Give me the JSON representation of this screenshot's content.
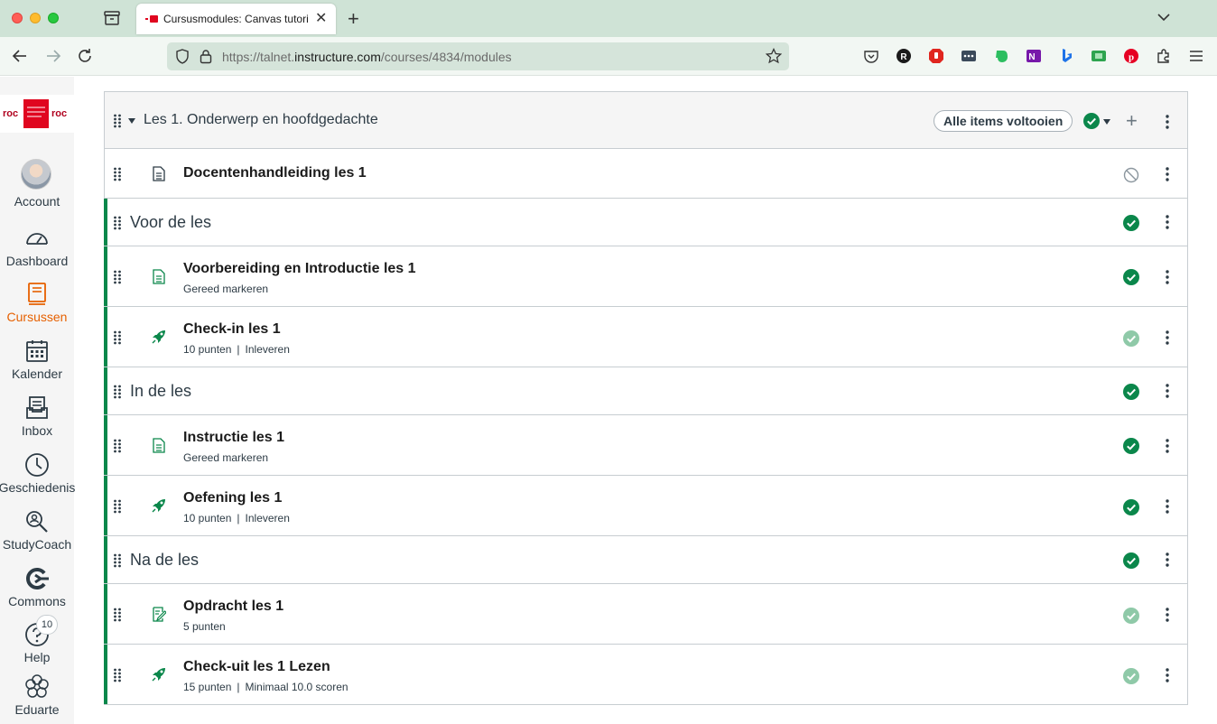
{
  "browser": {
    "tab_title": "Cursusmodules: Canvas tutorial",
    "url_prefix": "https://talnet.",
    "url_domain": "instructure.com",
    "url_path": "/courses/4834/modules"
  },
  "nav": {
    "items": [
      {
        "label": "Account"
      },
      {
        "label": "Dashboard"
      },
      {
        "label": "Cursussen"
      },
      {
        "label": "Kalender"
      },
      {
        "label": "Inbox"
      },
      {
        "label": "Geschiedenis"
      },
      {
        "label": "StudyCoach"
      },
      {
        "label": "Commons"
      },
      {
        "label": "Help",
        "badge": "10"
      },
      {
        "label": "Eduarte"
      }
    ],
    "active_color": "#e66000"
  },
  "module": {
    "title": "Les 1. Onderwerp en hoofdgedachte",
    "complete_all_label": "Alle items voltooien",
    "rows": [
      {
        "title": "Docentenhandleiding les 1"
      },
      {
        "header": "Voor de les"
      },
      {
        "title": "Voorbereiding en Introductie les 1",
        "sub": "Gereed markeren"
      },
      {
        "title": "Check-in les 1",
        "points": "10 punten",
        "req": "Inleveren"
      },
      {
        "header": "In de les"
      },
      {
        "title": "Instructie les 1",
        "sub": "Gereed markeren"
      },
      {
        "title": "Oefening les 1",
        "points": "10 punten",
        "req": "Inleveren"
      },
      {
        "header": "Na de les"
      },
      {
        "title": "Opdracht les 1",
        "sub": "5 punten"
      },
      {
        "title": "Check-uit les 1 Lezen",
        "points": "15 punten",
        "req": "Minimaal 10.0 scoren"
      }
    ]
  },
  "colors": {
    "complete_green": "#0b874b",
    "pending_green": "#8fc9a8"
  }
}
